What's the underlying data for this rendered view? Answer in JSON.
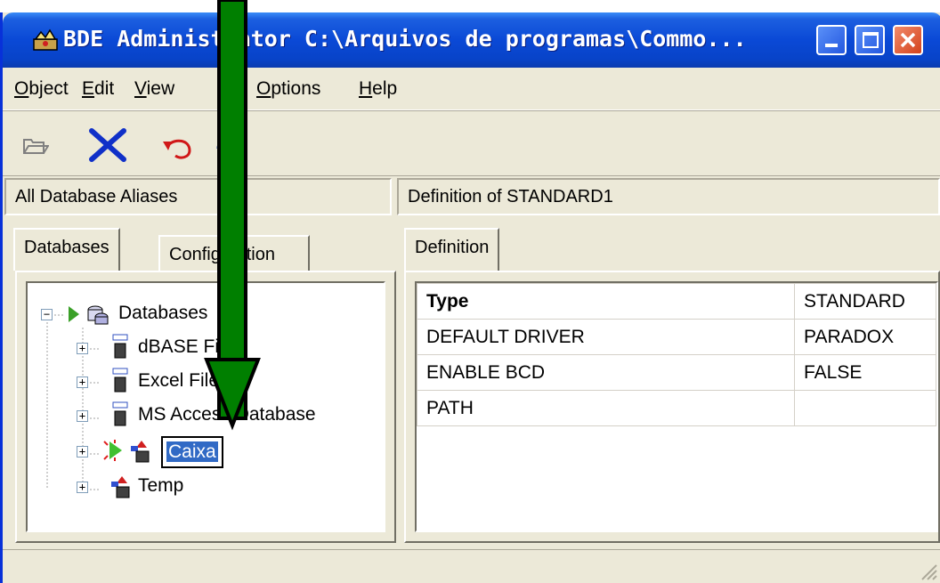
{
  "window": {
    "title": "BDE Administrator  C:\\Arquivos de programas\\Commo...",
    "buttons": {
      "minimize": "minimize",
      "maximize": "maximize",
      "close": "close"
    }
  },
  "menu": [
    "Object",
    "Edit",
    "View",
    "Options",
    "Help"
  ],
  "toolbar": [
    "open-icon",
    "delete-icon",
    "undo-icon",
    "apply-icon"
  ],
  "left_header": "All Database Aliases",
  "right_header": "Definition of STANDARD1",
  "left_tabs": [
    "Databases",
    "Configuration"
  ],
  "right_tab": "Definition",
  "tree": {
    "root": "Databases",
    "items": [
      "dBASE Files",
      "Excel Files",
      "MS Access Database",
      "Caixa",
      "Temp"
    ],
    "editing": "Caixa"
  },
  "definition": {
    "rows": [
      {
        "key": "Type",
        "value": "STANDARD"
      },
      {
        "key": "DEFAULT DRIVER",
        "value": "PARADOX"
      },
      {
        "key": "ENABLE BCD",
        "value": "FALSE"
      },
      {
        "key": "PATH",
        "value": ""
      }
    ]
  },
  "colors": {
    "arrow": "#007f00",
    "titlebar": "#0a49d6",
    "selection": "#316ac5"
  }
}
